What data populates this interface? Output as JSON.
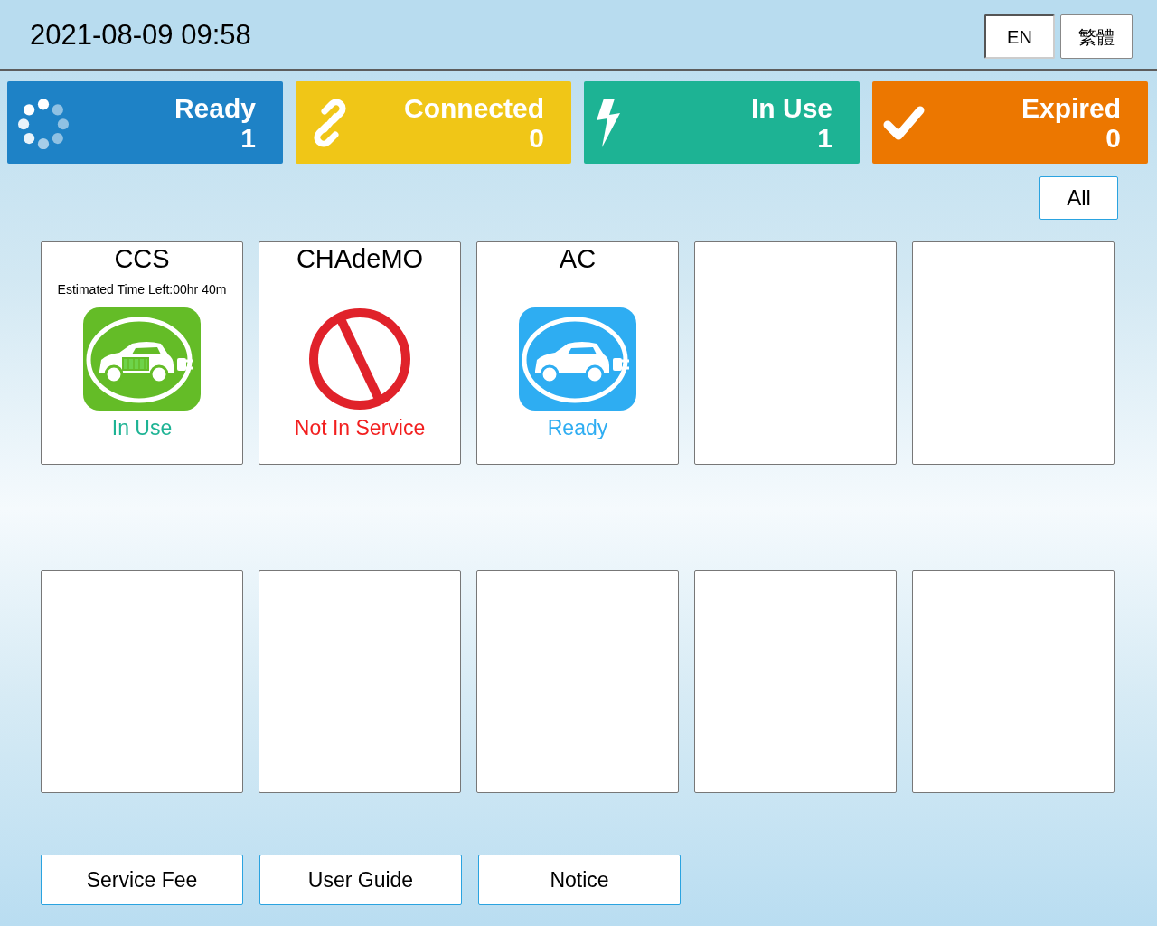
{
  "header": {
    "datetime": "2021-08-09 09:58",
    "languages": [
      {
        "label": "EN",
        "selected": true
      },
      {
        "label": "繁體",
        "selected": false
      }
    ]
  },
  "summary": [
    {
      "kind": "ready",
      "label": "Ready",
      "count": "1"
    },
    {
      "kind": "connected",
      "label": "Connected",
      "count": "0"
    },
    {
      "kind": "in_use",
      "label": "In Use",
      "count": "1"
    },
    {
      "kind": "expired",
      "label": "Expired",
      "count": "0"
    }
  ],
  "filter": {
    "label": "All"
  },
  "chargers": [
    {
      "kind": "in_use",
      "name": "CCS",
      "time_left": "Estimated Time Left:00hr 40m",
      "status": "In Use"
    },
    {
      "kind": "out_of_service",
      "name": "CHAdeMO",
      "status": "Not In Service"
    },
    {
      "kind": "ready",
      "name": "AC",
      "status": "Ready"
    },
    {
      "kind": "empty"
    },
    {
      "kind": "empty"
    },
    {
      "kind": "empty"
    },
    {
      "kind": "empty"
    },
    {
      "kind": "empty"
    },
    {
      "kind": "empty"
    },
    {
      "kind": "empty"
    }
  ],
  "footer_buttons": [
    "Service Fee",
    "User Guide",
    "Notice"
  ]
}
